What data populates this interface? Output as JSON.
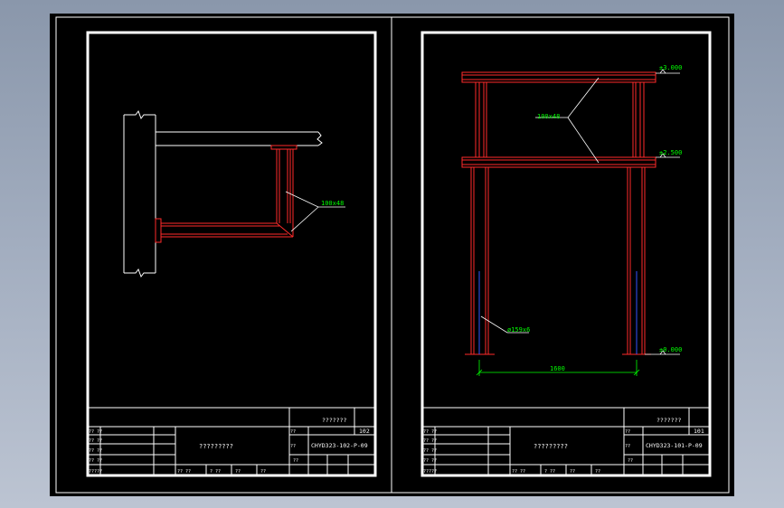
{
  "left_sheet": {
    "title_code": "???????",
    "sheet_no": "102",
    "sheet_label": "??",
    "drawing_no": "CHYD323-102-P-09",
    "drawing_no_label": "??",
    "center_title": "?????????",
    "member_label": "100x48",
    "row_labels": [
      "?????",
      "?? ??",
      "?? ??",
      "?? ??",
      "?? ??"
    ],
    "footer": [
      "?? ??",
      "? ??",
      "??",
      "??",
      "??"
    ]
  },
  "right_sheet": {
    "title_code": "???????",
    "sheet_no": "101",
    "sheet_label": "??",
    "drawing_no": "CHYD323-101-P-09",
    "drawing_no_label": "??",
    "center_title": "?????????",
    "member_label": "100x48",
    "pipe_label": "ø159x6",
    "dim_width": "1600",
    "elev_top": "±3.000",
    "elev_mid": "±2.500",
    "elev_base": "±0.000",
    "row_labels": [
      "?????",
      "?? ??",
      "?? ??",
      "?? ??",
      "?? ??"
    ],
    "footer": [
      "?? ??",
      "? ??",
      "??",
      "??",
      "??"
    ]
  }
}
